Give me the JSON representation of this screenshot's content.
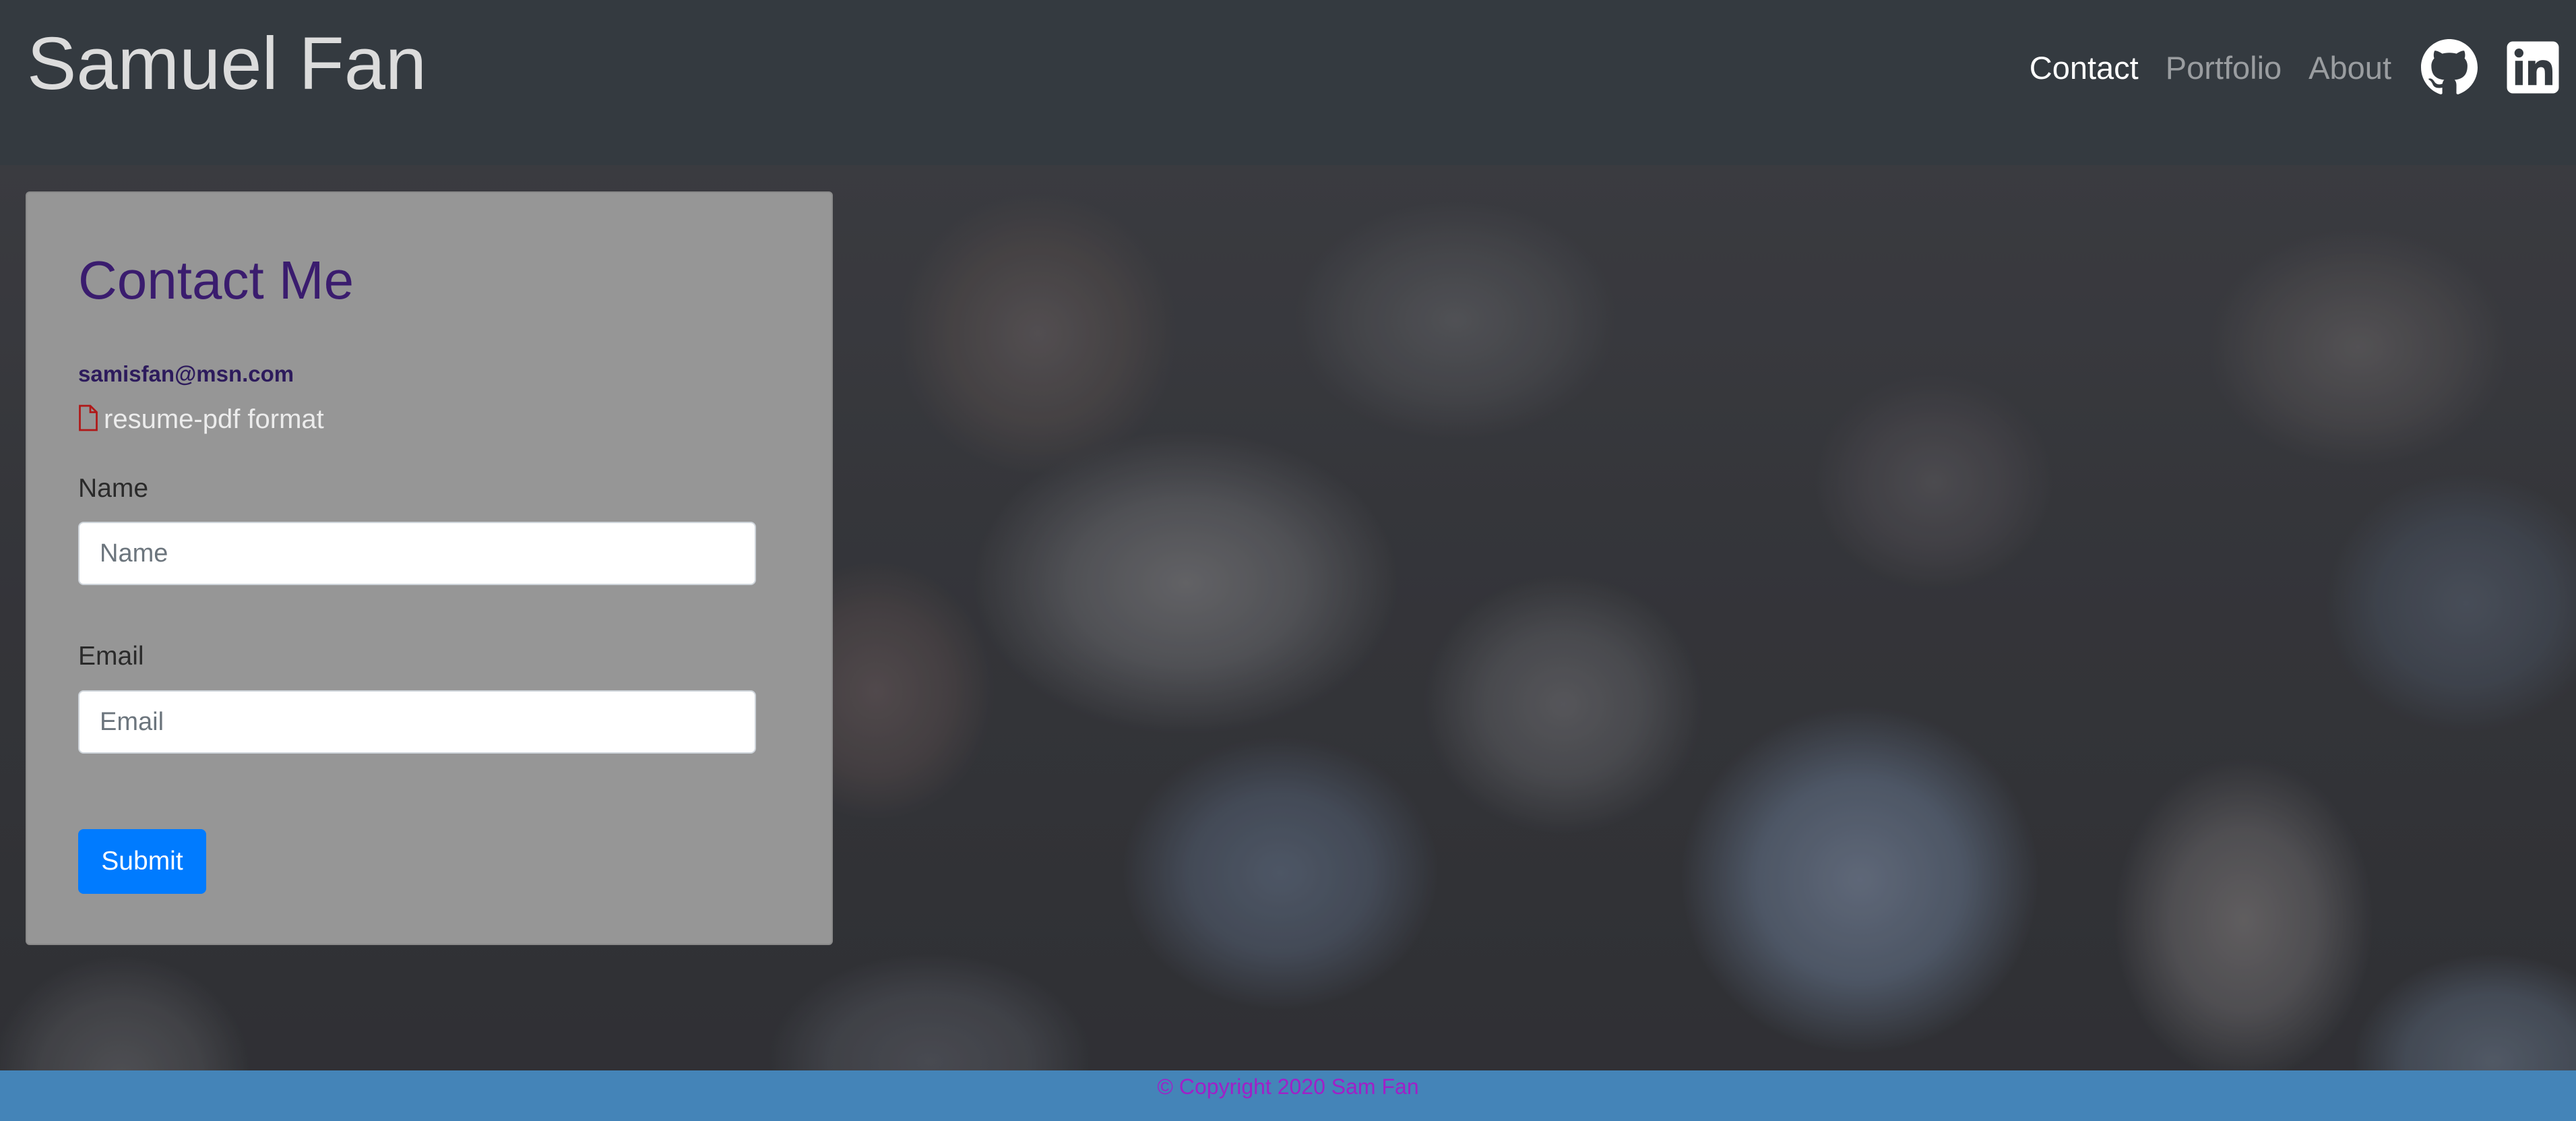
{
  "header": {
    "brand": "Samuel Fan",
    "nav": [
      {
        "label": "Contact",
        "active": true
      },
      {
        "label": "Portfolio",
        "active": false
      },
      {
        "label": "About",
        "active": false
      }
    ],
    "icons": [
      "github-icon",
      "linkedin-icon"
    ]
  },
  "contact": {
    "title": "Contact Me",
    "email": "samisfan@msn.com",
    "resume_label": "resume-pdf format",
    "resume_icon": "file-icon",
    "fields": {
      "name_label": "Name",
      "name_placeholder": "Name",
      "email_label": "Email",
      "email_placeholder": "Email"
    },
    "submit_label": "Submit"
  },
  "footer": {
    "copyright": "© Copyright 2020 Sam Fan"
  },
  "colors": {
    "navbar": "#343a40",
    "card": "#969696",
    "title": "#3a1c6e",
    "primary_button": "#007bff",
    "footer": "#4484b8",
    "footer_text": "#a020c8"
  }
}
